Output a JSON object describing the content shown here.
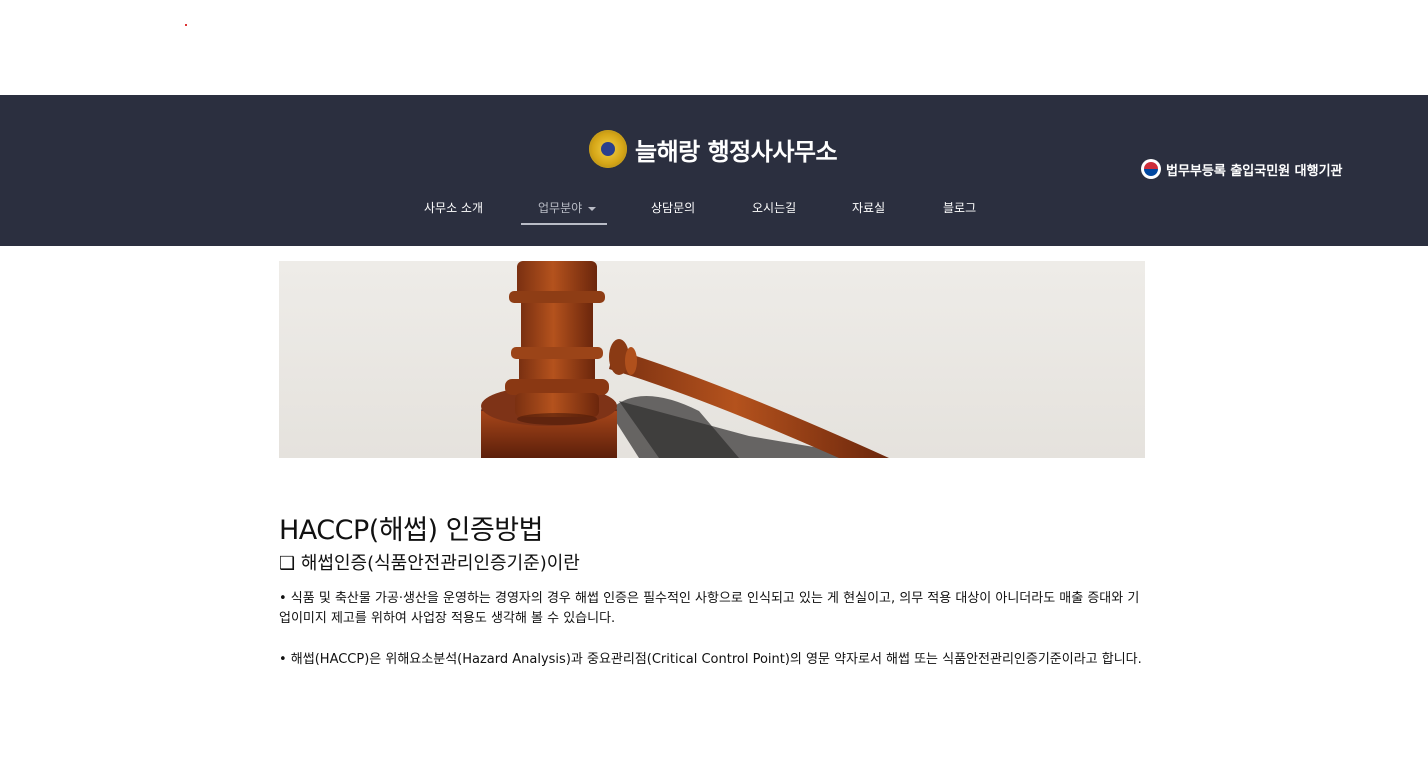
{
  "header": {
    "brand_name": "늘해랑 행정사사무소",
    "badge_text": "법무부등록 출입국민원 대행기관"
  },
  "nav": {
    "items": [
      {
        "label": "사무소 소개"
      },
      {
        "label": "업무분야"
      },
      {
        "label": "상담문의"
      },
      {
        "label": "오시는길"
      },
      {
        "label": "자료실"
      },
      {
        "label": "블로그"
      }
    ],
    "active": "업무분야"
  },
  "content": {
    "title": "HACCP(해썹) 인증방법",
    "section_heading": "❑ 해썹인증(식품안전관리인증기준)이란",
    "paragraph1": "• 식품 및 축산물 가공·생산을 운영하는 경영자의 경우 해썹 인증은 필수적인 사항으로 인식되고 있는 게 현실이고, 의무 적용 대상이 아니더라도 매출 증대와 기업이미지 제고를 위하여 사업장 적용도 생각해 볼 수 있습니다.",
    "paragraph2": "• 해썹(HACCP)은 위해요소분석(Hazard Analysis)과 중요관리점(Critical Control Point)의 영문 약자로서 해썹 또는 식품안전관리인증기준이라고 합니다."
  },
  "colors": {
    "header_bg": "#2b2f3f",
    "nav_text": "#ffffff",
    "nav_active": "#b9bcc6"
  },
  "icons": {
    "emblem": "gold-emblem-icon",
    "badge": "taegeuk-icon",
    "hero": "judge-gavel-image"
  }
}
